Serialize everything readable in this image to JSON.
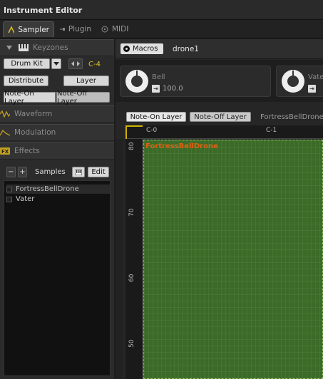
{
  "window": {
    "title": "Instrument Editor"
  },
  "tabs": [
    {
      "label": "Sampler",
      "icon": "sampler-wave-icon",
      "active": true
    },
    {
      "label": "Plugin",
      "icon": "plugin-icon",
      "active": false
    },
    {
      "label": "MIDI",
      "icon": "midi-icon",
      "active": false
    }
  ],
  "left": {
    "keyzones_label": "Keyzones",
    "drum_kit_label": "Drum Kit",
    "root_note": "C-4",
    "distribute_label": "Distribute",
    "layer_label": "Layer",
    "note_on_label": "Note-On Layer",
    "note_off_label": "Note-Off Layer",
    "waveform_label": "Waveform",
    "modulation_label": "Modulation",
    "effects_label": "Effects",
    "samples_label": "Samples",
    "edit_label": "Edit",
    "minus": "−",
    "plus": "+",
    "samples": [
      "FortressBellDrone",
      "Vater"
    ]
  },
  "right": {
    "macros_label": "Macros",
    "preset_name": "drone1",
    "macros": [
      {
        "name": "Bell",
        "value": "100.0"
      },
      {
        "name": "Vater",
        "value": ""
      }
    ],
    "note_on_label": "Note-On Layer",
    "note_off_label": "Note-Off Layer",
    "layer_sample_name": "FortressBellDrone",
    "ruler_labels": [
      "C-0",
      "C-1"
    ],
    "vertical_labels": [
      "80",
      "70",
      "60",
      "50"
    ],
    "zone_label": "FortressBellDrone"
  },
  "colors": {
    "accent_yellow": "#e0c020",
    "zone_green": "#3c6b27",
    "zone_label": "#e06010"
  }
}
